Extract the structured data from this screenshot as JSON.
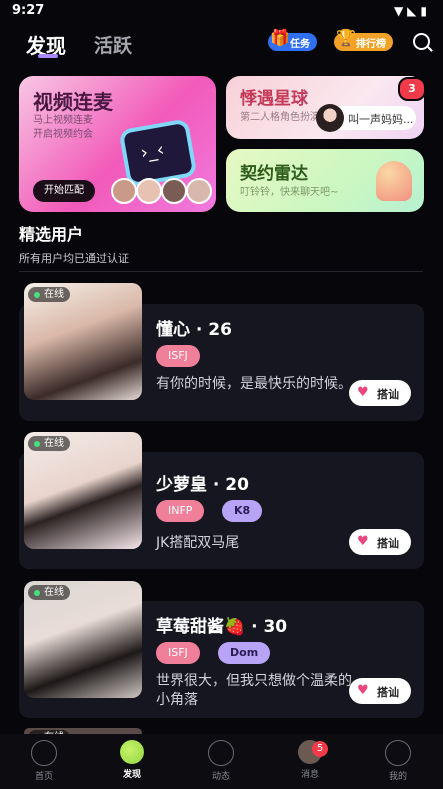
{
  "status": {
    "time": "9:27"
  },
  "header": {
    "tabs": [
      {
        "label": "发现"
      },
      {
        "label": "活跃"
      }
    ],
    "task_label": "任务",
    "rank_label": "排行榜"
  },
  "cards": {
    "video": {
      "title": "视频连麦",
      "sub_line1": "马上视频连麦",
      "sub_line2": "开启视频约会",
      "button": "开始匹配"
    },
    "planet": {
      "title": "悸遇星球",
      "sub": "第二人格角色扮演",
      "bubble": "叫一声妈妈...",
      "badge": "3"
    },
    "radar": {
      "title": "契约雷达",
      "sub": "叮铃铃，快来聊天吧~"
    }
  },
  "section": {
    "title": "精选用户",
    "sub": "所有用户均已通过认证"
  },
  "users": [
    {
      "online": "在线",
      "name": "懂心 · 26",
      "tags": [
        "ISFJ"
      ],
      "bio": "有你的时候，是最快乐的时候。",
      "action": "搭讪"
    },
    {
      "online": "在线",
      "name": "少萝皇 · 20",
      "tags": [
        "INFP",
        "K8"
      ],
      "bio": "JK搭配双马尾",
      "action": "搭讪"
    },
    {
      "online": "在线",
      "name": "草莓甜酱🍓 · 30",
      "tags": [
        "ISFJ",
        "Dom"
      ],
      "bio": "世界很大，但我只想做个温柔的小角落",
      "action": "搭讪"
    }
  ],
  "partial_online": "在线",
  "nav": {
    "items": [
      {
        "label": "首页"
      },
      {
        "label": "发现"
      },
      {
        "label": "动态"
      },
      {
        "label": "消息"
      },
      {
        "label": "我的"
      }
    ],
    "message_badge": "5"
  }
}
